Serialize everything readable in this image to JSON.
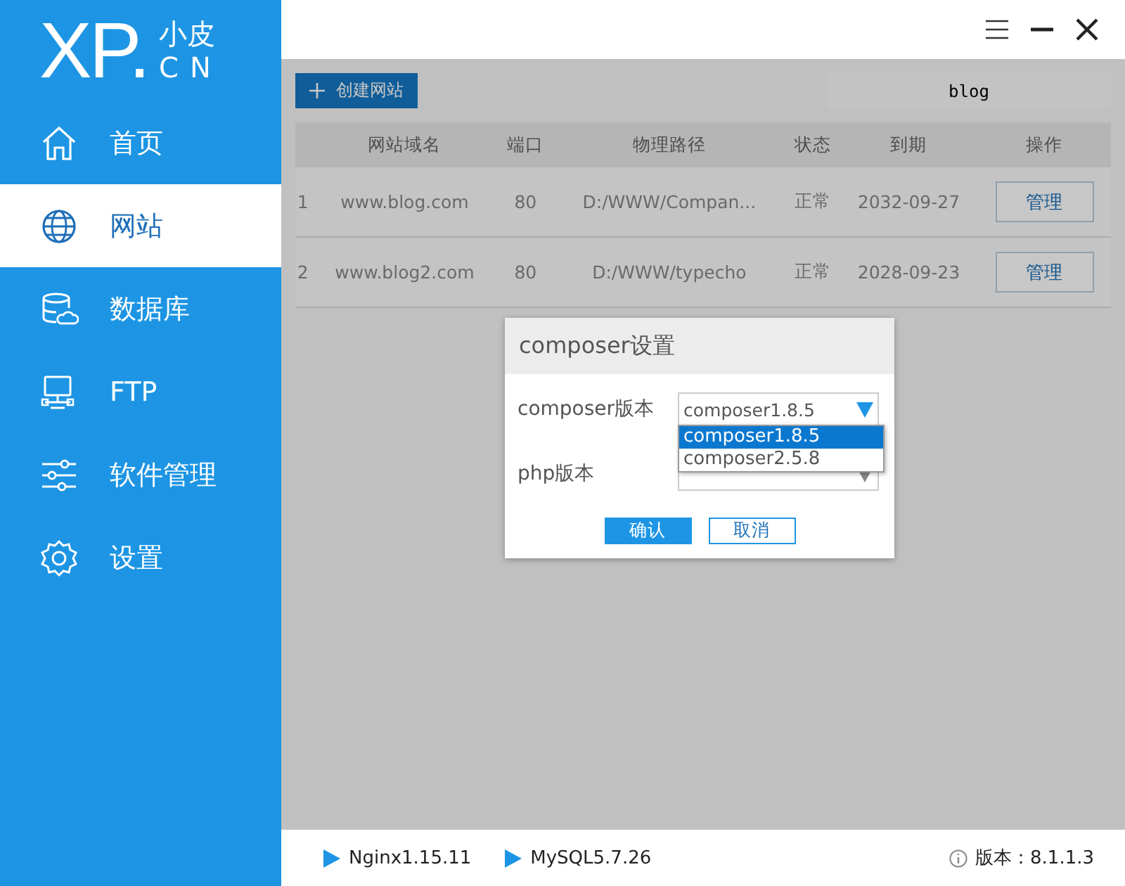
{
  "logo": {
    "mark": "XP.",
    "top": "小皮",
    "bottom": "CN"
  },
  "sidebar": {
    "items": [
      {
        "label": "首页",
        "kind": "home",
        "selected": false
      },
      {
        "label": "网站",
        "kind": "globe",
        "selected": true
      },
      {
        "label": "数据库",
        "kind": "database",
        "selected": false
      },
      {
        "label": "FTP",
        "kind": "ftp",
        "selected": false
      },
      {
        "label": "软件管理",
        "kind": "sliders",
        "selected": false
      },
      {
        "label": "设置",
        "kind": "gear",
        "selected": false
      }
    ]
  },
  "toolbar": {
    "create_button": "创建网站",
    "search": {
      "value": "blog"
    }
  },
  "table": {
    "columns": [
      "",
      "网站域名",
      "端口",
      "物理路径",
      "状态",
      "到期",
      "操作"
    ],
    "rows": [
      {
        "cells": [
          "1",
          "www.blog.com",
          "80",
          "D:/WWW/Compan...",
          "正常",
          "2032-09-27"
        ],
        "action": "管理"
      },
      {
        "cells": [
          "2",
          "www.blog2.com",
          "80",
          "D:/WWW/typecho",
          "正常",
          "2028-09-23"
        ],
        "action": "管理"
      }
    ]
  },
  "dialog": {
    "title": "composer设置",
    "fields": [
      {
        "label": "composer版本",
        "value": "composer1.8.5",
        "open": true,
        "options": [
          {
            "label": "composer1.8.5",
            "selected": true
          },
          {
            "label": "composer2.5.8",
            "selected": false
          }
        ]
      },
      {
        "label": "php版本",
        "open": false
      }
    ],
    "buttons": [
      {
        "label": "确认",
        "kind": "primary"
      },
      {
        "label": "取消",
        "kind": "secondary"
      }
    ]
  },
  "status_bar": {
    "services": [
      "Nginx1.15.11",
      "MySQL5.7.26"
    ],
    "version": "版本：8.1.1.3"
  }
}
